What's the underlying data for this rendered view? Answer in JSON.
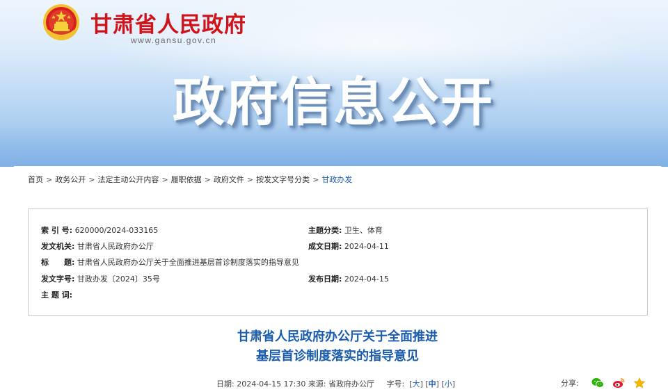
{
  "header": {
    "site_title": "甘肃省人民政府",
    "site_url": "www.gansu.gov.cn",
    "banner_heading": "政府信息公开",
    "emblem_icon": "national-emblem-icon"
  },
  "breadcrumb": [
    {
      "label": "首页"
    },
    {
      "label": "政务公开"
    },
    {
      "label": "法定主动公开内容"
    },
    {
      "label": "履职依据"
    },
    {
      "label": "政府文件"
    },
    {
      "label": "按发文字号分类"
    },
    {
      "label": "甘政办发"
    }
  ],
  "breadcrumb_separator": ">",
  "info": {
    "index_label": "索 引 号:",
    "index_value": "620000/2024-033165",
    "category_label": "主题分类:",
    "category_value": "卫生、体育",
    "issuer_label": "发文机关:",
    "issuer_value": "甘肃省人民政府办公厅",
    "date_written_label": "成文日期:",
    "date_written_value": "2024-04-11",
    "title_label": "标　　题:",
    "title_value": "甘肃省人民政府办公厅关于全面推进基层首诊制度落实的指导意见",
    "doc_number_label": "发文字号:",
    "doc_number_value": "甘政办发〔2024〕35号",
    "publish_date_label": "发布日期:",
    "publish_date_value": "2024-04-15",
    "keywords_label": "主 题 词:",
    "keywords_value": ""
  },
  "document": {
    "title_line1": "甘肃省人民政府办公厅关于全面推进",
    "title_line2": "基层首诊制度落实的指导意见"
  },
  "meta": {
    "date_label": "日期:",
    "date_value": "2024-04-15 17:30",
    "source_label": "来源:",
    "source_value": "省政府办公厅",
    "fontsize_label": "字号:",
    "size_large": "大",
    "size_medium": "中",
    "size_small": "小"
  },
  "share": {
    "label": "分享:",
    "icons": [
      "wechat-icon",
      "weibo-icon",
      "favorite-star-icon"
    ]
  },
  "colors": {
    "title_red": "#d0121a",
    "link_blue": "#1a5cae",
    "wechat_green": "#28b400",
    "weibo_red": "#e6162d",
    "star_gold": "#f5b800"
  }
}
